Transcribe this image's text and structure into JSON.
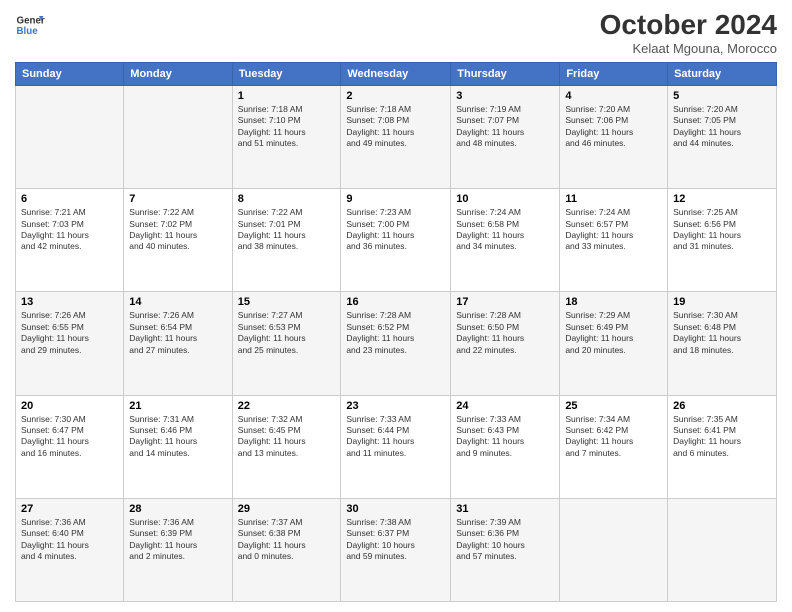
{
  "header": {
    "logo_line1": "General",
    "logo_line2": "Blue",
    "month": "October 2024",
    "location": "Kelaat Mgouna, Morocco"
  },
  "days_of_week": [
    "Sunday",
    "Monday",
    "Tuesday",
    "Wednesday",
    "Thursday",
    "Friday",
    "Saturday"
  ],
  "weeks": [
    [
      {
        "day": "",
        "info": ""
      },
      {
        "day": "",
        "info": ""
      },
      {
        "day": "1",
        "info": "Sunrise: 7:18 AM\nSunset: 7:10 PM\nDaylight: 11 hours\nand 51 minutes."
      },
      {
        "day": "2",
        "info": "Sunrise: 7:18 AM\nSunset: 7:08 PM\nDaylight: 11 hours\nand 49 minutes."
      },
      {
        "day": "3",
        "info": "Sunrise: 7:19 AM\nSunset: 7:07 PM\nDaylight: 11 hours\nand 48 minutes."
      },
      {
        "day": "4",
        "info": "Sunrise: 7:20 AM\nSunset: 7:06 PM\nDaylight: 11 hours\nand 46 minutes."
      },
      {
        "day": "5",
        "info": "Sunrise: 7:20 AM\nSunset: 7:05 PM\nDaylight: 11 hours\nand 44 minutes."
      }
    ],
    [
      {
        "day": "6",
        "info": "Sunrise: 7:21 AM\nSunset: 7:03 PM\nDaylight: 11 hours\nand 42 minutes."
      },
      {
        "day": "7",
        "info": "Sunrise: 7:22 AM\nSunset: 7:02 PM\nDaylight: 11 hours\nand 40 minutes."
      },
      {
        "day": "8",
        "info": "Sunrise: 7:22 AM\nSunset: 7:01 PM\nDaylight: 11 hours\nand 38 minutes."
      },
      {
        "day": "9",
        "info": "Sunrise: 7:23 AM\nSunset: 7:00 PM\nDaylight: 11 hours\nand 36 minutes."
      },
      {
        "day": "10",
        "info": "Sunrise: 7:24 AM\nSunset: 6:58 PM\nDaylight: 11 hours\nand 34 minutes."
      },
      {
        "day": "11",
        "info": "Sunrise: 7:24 AM\nSunset: 6:57 PM\nDaylight: 11 hours\nand 33 minutes."
      },
      {
        "day": "12",
        "info": "Sunrise: 7:25 AM\nSunset: 6:56 PM\nDaylight: 11 hours\nand 31 minutes."
      }
    ],
    [
      {
        "day": "13",
        "info": "Sunrise: 7:26 AM\nSunset: 6:55 PM\nDaylight: 11 hours\nand 29 minutes."
      },
      {
        "day": "14",
        "info": "Sunrise: 7:26 AM\nSunset: 6:54 PM\nDaylight: 11 hours\nand 27 minutes."
      },
      {
        "day": "15",
        "info": "Sunrise: 7:27 AM\nSunset: 6:53 PM\nDaylight: 11 hours\nand 25 minutes."
      },
      {
        "day": "16",
        "info": "Sunrise: 7:28 AM\nSunset: 6:52 PM\nDaylight: 11 hours\nand 23 minutes."
      },
      {
        "day": "17",
        "info": "Sunrise: 7:28 AM\nSunset: 6:50 PM\nDaylight: 11 hours\nand 22 minutes."
      },
      {
        "day": "18",
        "info": "Sunrise: 7:29 AM\nSunset: 6:49 PM\nDaylight: 11 hours\nand 20 minutes."
      },
      {
        "day": "19",
        "info": "Sunrise: 7:30 AM\nSunset: 6:48 PM\nDaylight: 11 hours\nand 18 minutes."
      }
    ],
    [
      {
        "day": "20",
        "info": "Sunrise: 7:30 AM\nSunset: 6:47 PM\nDaylight: 11 hours\nand 16 minutes."
      },
      {
        "day": "21",
        "info": "Sunrise: 7:31 AM\nSunset: 6:46 PM\nDaylight: 11 hours\nand 14 minutes."
      },
      {
        "day": "22",
        "info": "Sunrise: 7:32 AM\nSunset: 6:45 PM\nDaylight: 11 hours\nand 13 minutes."
      },
      {
        "day": "23",
        "info": "Sunrise: 7:33 AM\nSunset: 6:44 PM\nDaylight: 11 hours\nand 11 minutes."
      },
      {
        "day": "24",
        "info": "Sunrise: 7:33 AM\nSunset: 6:43 PM\nDaylight: 11 hours\nand 9 minutes."
      },
      {
        "day": "25",
        "info": "Sunrise: 7:34 AM\nSunset: 6:42 PM\nDaylight: 11 hours\nand 7 minutes."
      },
      {
        "day": "26",
        "info": "Sunrise: 7:35 AM\nSunset: 6:41 PM\nDaylight: 11 hours\nand 6 minutes."
      }
    ],
    [
      {
        "day": "27",
        "info": "Sunrise: 7:36 AM\nSunset: 6:40 PM\nDaylight: 11 hours\nand 4 minutes."
      },
      {
        "day": "28",
        "info": "Sunrise: 7:36 AM\nSunset: 6:39 PM\nDaylight: 11 hours\nand 2 minutes."
      },
      {
        "day": "29",
        "info": "Sunrise: 7:37 AM\nSunset: 6:38 PM\nDaylight: 11 hours\nand 0 minutes."
      },
      {
        "day": "30",
        "info": "Sunrise: 7:38 AM\nSunset: 6:37 PM\nDaylight: 10 hours\nand 59 minutes."
      },
      {
        "day": "31",
        "info": "Sunrise: 7:39 AM\nSunset: 6:36 PM\nDaylight: 10 hours\nand 57 minutes."
      },
      {
        "day": "",
        "info": ""
      },
      {
        "day": "",
        "info": ""
      }
    ]
  ]
}
